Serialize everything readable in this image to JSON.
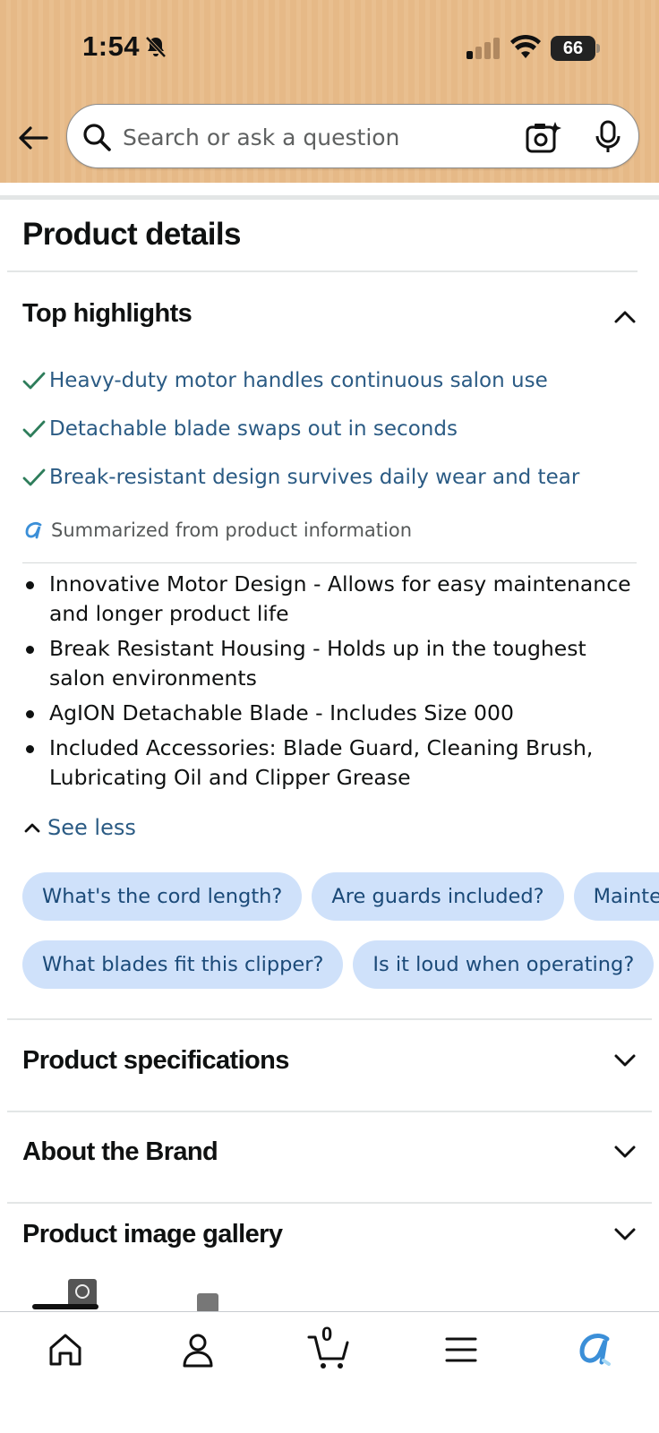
{
  "status_bar": {
    "time": "1:54",
    "battery": "66",
    "icons": [
      "bell-muted-icon",
      "cellular-signal-icon",
      "wifi-icon",
      "battery-icon"
    ]
  },
  "header": {
    "back_icon": "back-arrow-icon",
    "search_placeholder": "Search or ask a question",
    "camera_icon": "camera-search-icon",
    "mic_icon": "microphone-icon"
  },
  "product_details": {
    "title": "Product details",
    "top_highlights": {
      "title": "Top highlights",
      "expanded": true,
      "highlights": [
        "Heavy-duty motor handles continuous salon use",
        "Detachable blade swaps out in seconds",
        "Break-resistant design survives daily wear and tear"
      ],
      "summary_note": "Summarized from product information",
      "bullets": [
        "Innovative Motor Design - Allows for easy maintenance and longer product life",
        "Break Resistant Housing - Holds up in the toughest salon environments",
        "AgION Detachable Blade - Includes Size 000",
        "Included Accessories: Blade Guard, Cleaning Brush, Lubricating Oil and Clipper Grease"
      ],
      "see_less_label": "See less"
    },
    "question_chips_row1": [
      "What's the cord length?",
      "Are guards included?",
      "Mainte"
    ],
    "question_chips_row2": [
      "What blades fit this clipper?",
      "Is it loud when operating?"
    ],
    "sections": [
      {
        "title": "Product specifications"
      },
      {
        "title": "About the Brand"
      },
      {
        "title": "Product image gallery"
      }
    ]
  },
  "bottom_nav": {
    "items": [
      "home-icon",
      "account-icon",
      "cart-icon",
      "menu-icon",
      "rufus-ai-icon"
    ],
    "cart_count": "0"
  },
  "colors": {
    "header_bg": "#e6b987",
    "link_blue": "#2b5b84",
    "chip_bg": "#cfe1fa",
    "check_green": "#2e7d5b"
  }
}
